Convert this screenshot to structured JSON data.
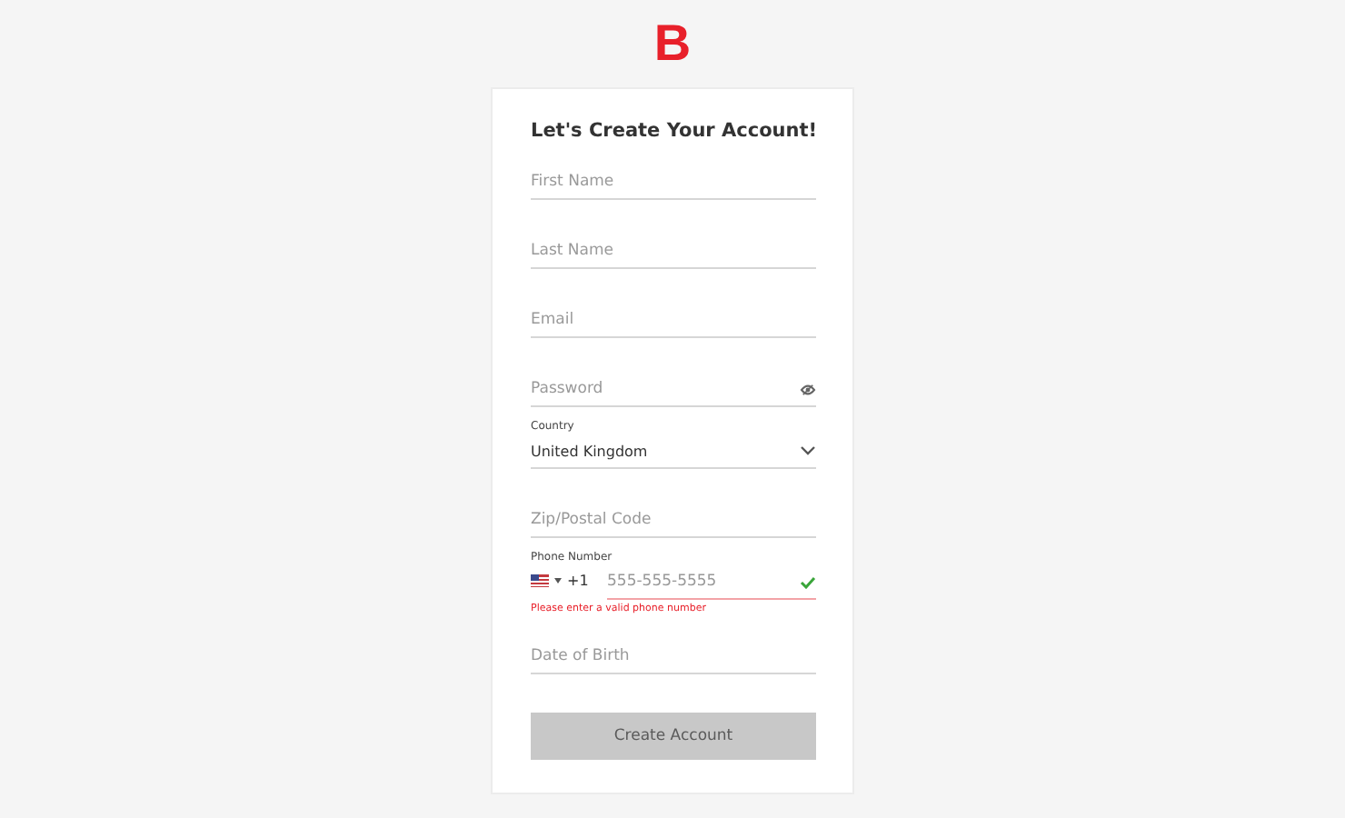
{
  "logo": "B",
  "title": "Let's Create Your Account!",
  "fields": [
    {
      "kind": "text",
      "placeholder": "First Name"
    },
    {
      "kind": "text",
      "placeholder": "Last Name"
    },
    {
      "kind": "text",
      "placeholder": "Email"
    },
    {
      "kind": "password",
      "placeholder": "Password"
    },
    {
      "kind": "select",
      "label": "Country",
      "value": "United Kingdom"
    },
    {
      "kind": "text",
      "placeholder": "Zip/Postal Code"
    },
    {
      "kind": "phone",
      "label": "Phone Number",
      "code": "+1",
      "placeholder": "555-555-5555",
      "valid": true,
      "error": "Please enter a valid phone number"
    },
    {
      "kind": "text",
      "placeholder": "Date of Birth"
    }
  ],
  "submit": {
    "label": "Create Account",
    "disabled": true
  }
}
